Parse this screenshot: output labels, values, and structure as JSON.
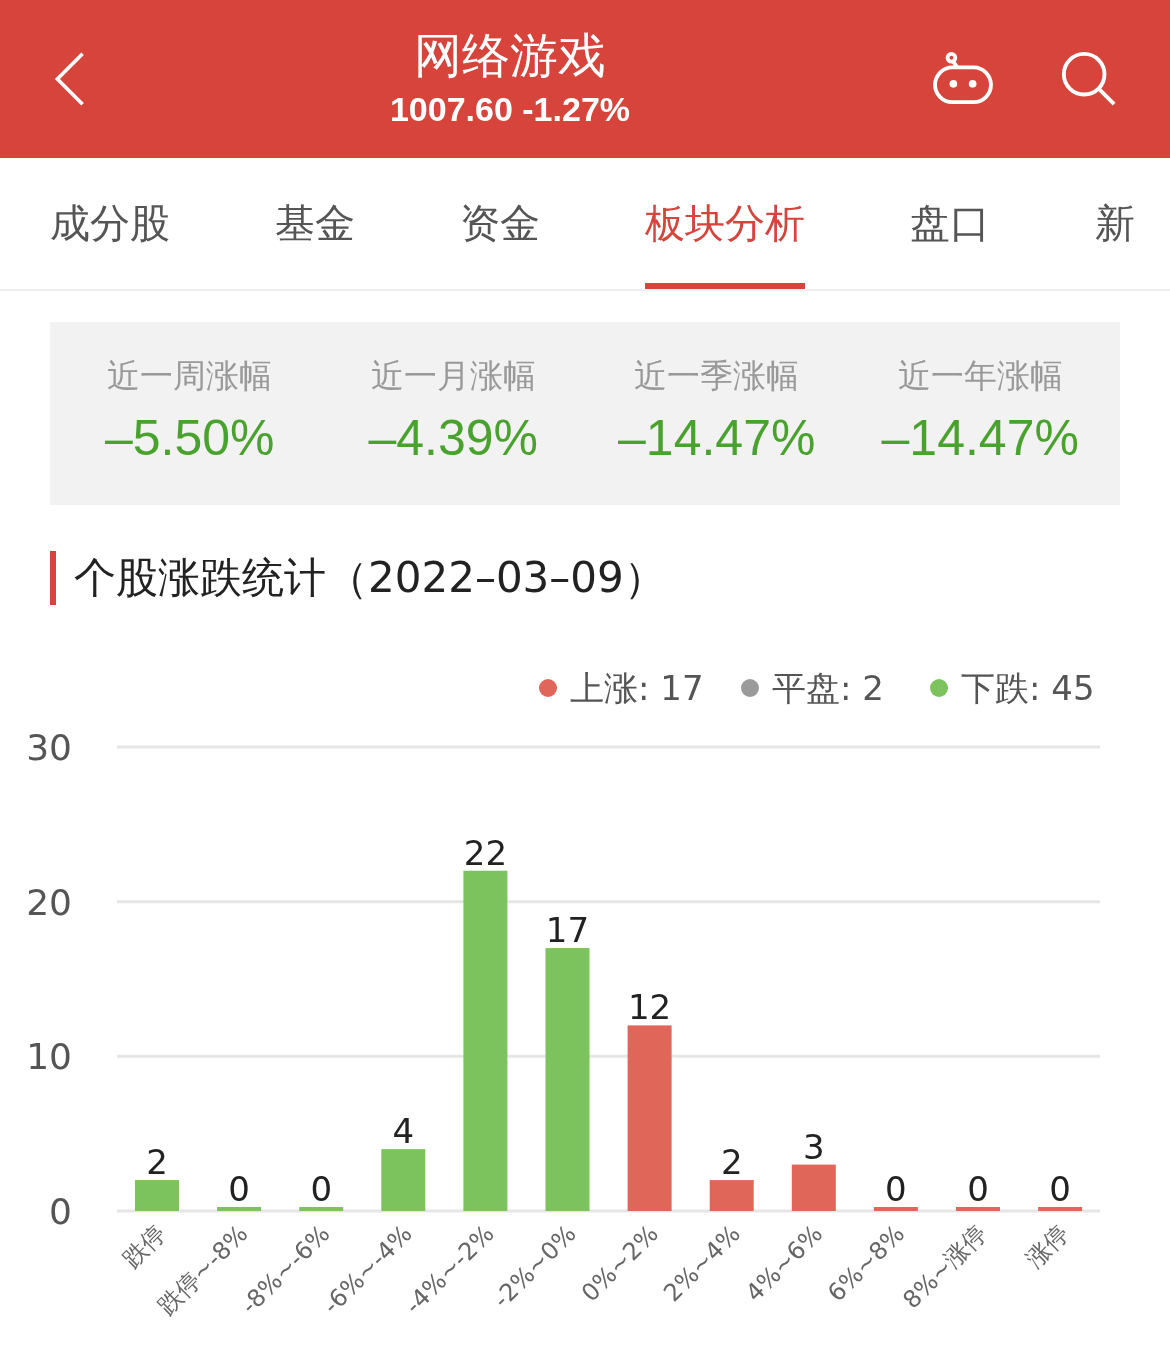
{
  "header": {
    "title": "网络游戏",
    "subtitle": "1007.60 -1.27%"
  },
  "tabs": [
    {
      "label": "成分股",
      "selected": false
    },
    {
      "label": "基金",
      "selected": false
    },
    {
      "label": "资金",
      "selected": false
    },
    {
      "label": "板块分析",
      "selected": true
    },
    {
      "label": "盘口",
      "selected": false
    },
    {
      "label": "新",
      "selected": false
    }
  ],
  "stats": [
    {
      "label": "近一周涨幅",
      "value": "–5.50%"
    },
    {
      "label": "近一月涨幅",
      "value": "–4.39%"
    },
    {
      "label": "近一季涨幅",
      "value": "–14.47%"
    },
    {
      "label": "近一年涨幅",
      "value": "–14.47%"
    }
  ],
  "section_title": "个股涨跌统计（2022–03–09）",
  "legend": [
    {
      "label": "上涨: 17",
      "color": "#e0665a"
    },
    {
      "label": "平盘: 2",
      "color": "#9a9a9a"
    },
    {
      "label": "下跌: 45",
      "color": "#7cc35e"
    }
  ],
  "chart_data": {
    "type": "bar",
    "categories": [
      "跌停",
      "跌停~-8%",
      "-8%~-6%",
      "-6%~-4%",
      "-4%~-2%",
      "-2%~0%",
      "0%~2%",
      "2%~4%",
      "4%~6%",
      "6%~8%",
      "8%~涨停",
      "涨停"
    ],
    "series": [
      {
        "color": "#7cc35e",
        "values": [
          2,
          0,
          0,
          4,
          22,
          17,
          null,
          null,
          null,
          null,
          null,
          null
        ]
      },
      {
        "color": "#e0665a",
        "values": [
          null,
          null,
          null,
          null,
          null,
          null,
          12,
          2,
          3,
          0,
          0,
          0
        ]
      }
    ],
    "ylim": [
      0,
      30
    ],
    "yticks": [
      0,
      10,
      20,
      30
    ],
    "data_labels": true
  }
}
